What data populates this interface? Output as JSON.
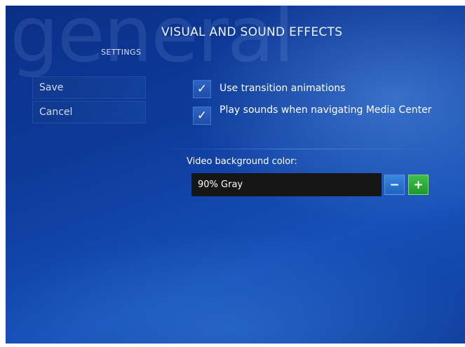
{
  "header": {
    "watermark": "general",
    "title": "VISUAL AND SOUND EFFECTS",
    "section": "SETTINGS"
  },
  "menu": {
    "items": [
      {
        "label": "Save"
      },
      {
        "label": "Cancel"
      }
    ]
  },
  "options": [
    {
      "label": "Use transition animations",
      "checked": true,
      "check_glyph": "✓"
    },
    {
      "label": "Play sounds when navigating Media Center",
      "checked": true,
      "check_glyph": "✓"
    }
  ],
  "video_background": {
    "label": "Video background color:",
    "value": "90% Gray",
    "decrement_label": "−",
    "increment_label": "+"
  },
  "colors": {
    "background": "#0d3a9a",
    "increment_button": "#2aa836",
    "decrement_button": "#2a72d0",
    "value_box": "#161616"
  }
}
